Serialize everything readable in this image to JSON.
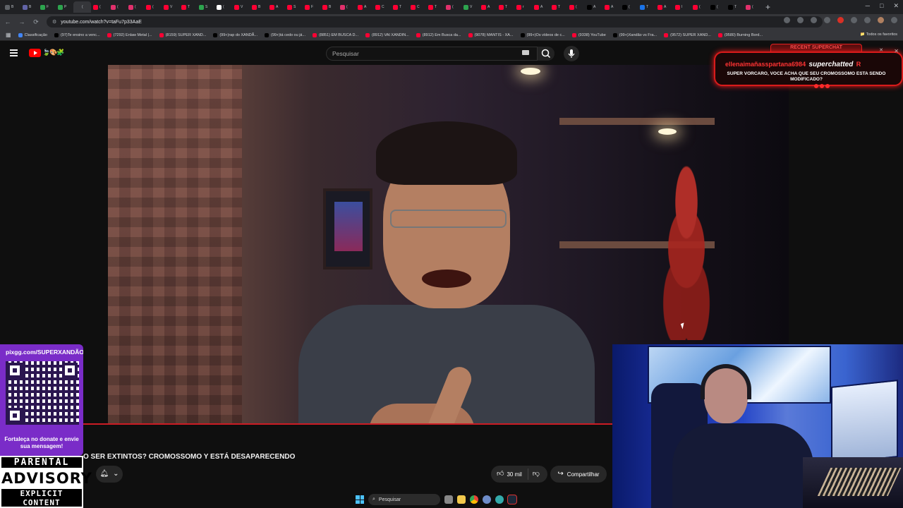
{
  "browser": {
    "url": "youtube.com/watch?v=taFu7p33AaE",
    "tabs": [
      {
        "label": "B",
        "color": "#5f6368",
        "active": false
      },
      {
        "label": "B",
        "color": "#6264a7",
        "active": false
      },
      {
        "label": "F",
        "color": "#2da44e",
        "active": false
      },
      {
        "label": "P",
        "color": "#2da44e",
        "active": false
      },
      {
        "label": "(",
        "color": "#35363a",
        "active": true
      },
      {
        "label": "(",
        "color": "#ff0033",
        "active": false
      },
      {
        "label": "(",
        "color": "#e1306c",
        "active": false
      },
      {
        "label": "(",
        "color": "#e1306c",
        "active": false
      },
      {
        "label": "(",
        "color": "#ff0033",
        "active": false
      },
      {
        "label": "V",
        "color": "#ff0033",
        "active": false
      },
      {
        "label": "T",
        "color": "#ff0033",
        "active": false
      },
      {
        "label": "S",
        "color": "#2da44e",
        "active": false
      },
      {
        "label": "(",
        "color": "#ffffff",
        "active": false
      },
      {
        "label": "V",
        "color": "#ff0033",
        "active": false
      },
      {
        "label": "B",
        "color": "#ff0033",
        "active": false
      },
      {
        "label": "A",
        "color": "#ff0033",
        "active": false
      },
      {
        "label": "S",
        "color": "#ff0033",
        "active": false
      },
      {
        "label": "F",
        "color": "#ff0033",
        "active": false
      },
      {
        "label": "B",
        "color": "#ff0033",
        "active": false
      },
      {
        "label": "(",
        "color": "#e1306c",
        "active": false
      },
      {
        "label": "A",
        "color": "#ff0033",
        "active": false
      },
      {
        "label": "C",
        "color": "#ff0033",
        "active": false
      },
      {
        "label": "T",
        "color": "#ff0033",
        "active": false
      },
      {
        "label": "C",
        "color": "#ff0033",
        "active": false
      },
      {
        "label": "T",
        "color": "#ff0033",
        "active": false
      },
      {
        "label": "(",
        "color": "#e1306c",
        "active": false
      },
      {
        "label": "V",
        "color": "#2da44e",
        "active": false
      },
      {
        "label": "A",
        "color": "#ff0033",
        "active": false
      },
      {
        "label": "T",
        "color": "#ff0033",
        "active": false
      },
      {
        "label": "r",
        "color": "#ff0033",
        "active": false
      },
      {
        "label": "A",
        "color": "#ff0033",
        "active": false
      },
      {
        "label": "T",
        "color": "#ff0033",
        "active": false
      },
      {
        "label": "(",
        "color": "#ff0033",
        "active": false
      },
      {
        "label": "A",
        "color": "#000000",
        "active": false
      },
      {
        "label": "A",
        "color": "#ff0033",
        "active": false
      },
      {
        "label": "(",
        "color": "#000000",
        "active": false
      },
      {
        "label": "T",
        "color": "#1a73e8",
        "active": false
      },
      {
        "label": "A",
        "color": "#ff0033",
        "active": false
      },
      {
        "label": "I",
        "color": "#ff0033",
        "active": false
      },
      {
        "label": "(",
        "color": "#ff0033",
        "active": false
      },
      {
        "label": "(",
        "color": "#000000",
        "active": false
      },
      {
        "label": "T",
        "color": "#000000",
        "active": false
      },
      {
        "label": "(",
        "color": "#e1306c",
        "active": false
      }
    ],
    "new_tab": "+",
    "bookmarks": [
      {
        "label": "Classificação",
        "color": "#4285f4"
      },
      {
        "label": "(97)Te ensino a venc...",
        "color": "#000000"
      },
      {
        "label": "(7292) Enlaw Metal |...",
        "color": "#ff0033"
      },
      {
        "label": "(8159) SUPER XAND...",
        "color": "#ff0033"
      },
      {
        "label": "(99+)rap do XANDÃ...",
        "color": "#000000"
      },
      {
        "label": "(99+)tá cedo ou já...",
        "color": "#000000"
      },
      {
        "label": "(8851) EM BUSCA D...",
        "color": "#ff0033"
      },
      {
        "label": "(8912) VAI XANDIN...",
        "color": "#ff0033"
      },
      {
        "label": "(8912) Em Busca da...",
        "color": "#ff0033"
      },
      {
        "label": "(9078) MANTIS - XA...",
        "color": "#ff0033"
      },
      {
        "label": "(99+)Os vídeos de c...",
        "color": "#000000"
      },
      {
        "label": "(9338) YouTube",
        "color": "#ff0033"
      },
      {
        "label": "(99+)Xandão vs Fra...",
        "color": "#000000"
      },
      {
        "label": "(9572) SUPER XAND...",
        "color": "#ff0033"
      },
      {
        "label": "(9580) Burning Bord...",
        "color": "#ff0033"
      }
    ],
    "all_favorites": "Todos os favoritos"
  },
  "youtube": {
    "logo_doodle": "🍃🎨🧩",
    "search_placeholder": "Pesquisar",
    "video_title": "O SER EXTINTOS? CROMOSSOMO Y ESTÁ DESAPARECENDO",
    "like_count": "30 mil",
    "share_label": "Compartilhar"
  },
  "superchat": {
    "header": "RECENT SUPERCHAT",
    "username": "ellenaimañasspartana6984",
    "verb": "superchatted",
    "amount_hint": "R",
    "message": "SUPER VORCARO, VOCE ACHA QUE SEU CROMOSSOMO ESTA SENDO MODIFICADO?"
  },
  "qr_panel": {
    "url": "pixgg.com/SUPERXANDÃO",
    "cta": "Fortaleça no donate e envie sua mensagem!"
  },
  "advisory": {
    "top": "PARENTAL",
    "middle": "ADVISORY",
    "bottom": "EXPLICIT CONTENT"
  },
  "taskbar": {
    "search_placeholder": "Pesquisar"
  },
  "colors": {
    "youtube_red": "#ff0000",
    "progress_red": "#cc1c24",
    "superchat_red": "#d81b1b",
    "qr_purple": "#7a2cc8",
    "webcam_blue": "#2848c8"
  }
}
